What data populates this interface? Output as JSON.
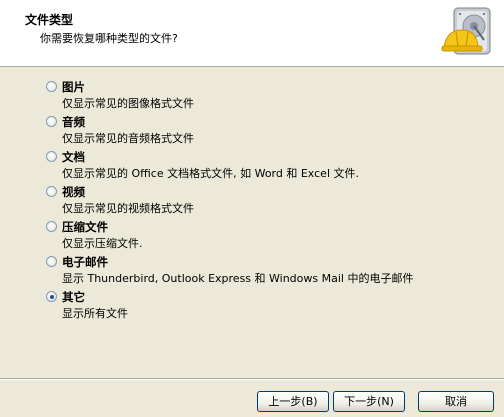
{
  "header": {
    "title": "文件类型",
    "subtitle": "你需要恢复哪种类型的文件?",
    "icon": "hard-drive-helmet-icon"
  },
  "options": [
    {
      "label": "图片",
      "description": "仅显示常见的图像格式文件",
      "checked": false
    },
    {
      "label": "音频",
      "description": "仅显示常见的音频格式文件",
      "checked": false
    },
    {
      "label": "文档",
      "description": "仅显示常见的 Office 文档格式文件, 如 Word 和 Excel 文件.",
      "checked": false
    },
    {
      "label": "视频",
      "description": "仅显示常见的视频格式文件",
      "checked": false
    },
    {
      "label": "压缩文件",
      "description": "仅显示压缩文件.",
      "checked": false
    },
    {
      "label": "电子邮件",
      "description": "显示 Thunderbird, Outlook Express 和 Windows Mail 中的电子邮件",
      "checked": false
    },
    {
      "label": "其它",
      "description": "显示所有文件",
      "checked": true
    }
  ],
  "buttons": {
    "back": "上一步(B)",
    "next": "下一步(N)",
    "cancel": "取消"
  },
  "colors": {
    "header_bg": "#ffffff",
    "window_bg": "#ece9d8",
    "radio_dot": "#1a4f9c",
    "button_border": "#003c74"
  }
}
